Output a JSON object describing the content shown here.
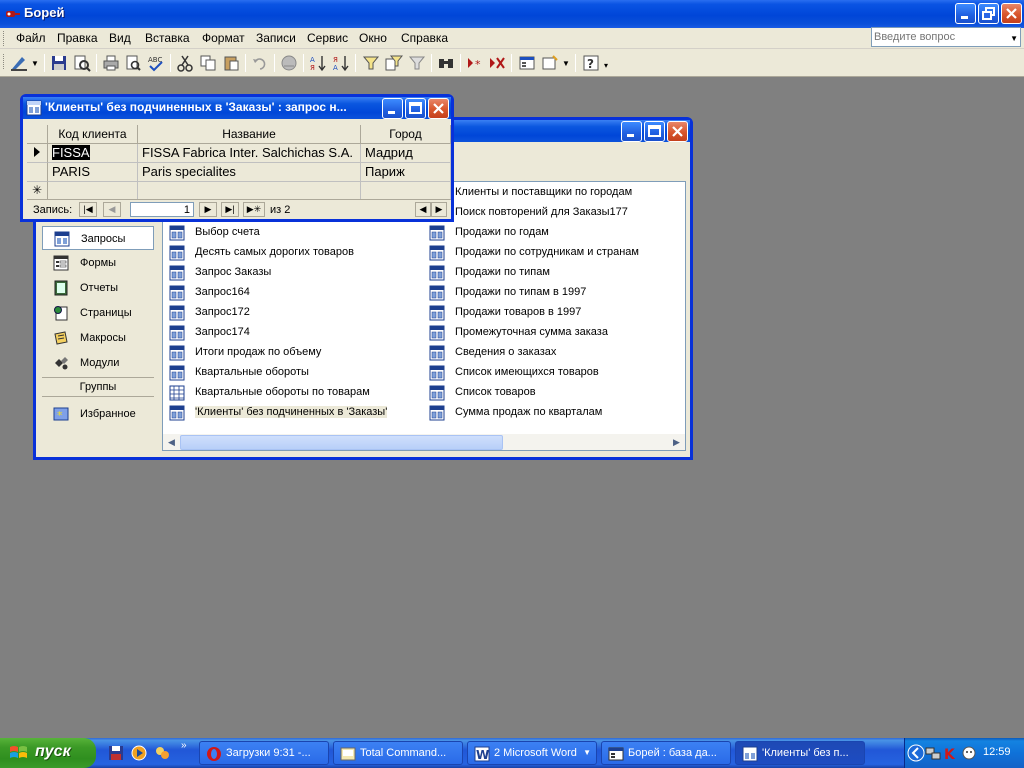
{
  "app": {
    "title": "Борей"
  },
  "menu": {
    "items": [
      "Файл",
      "Правка",
      "Вид",
      "Вставка",
      "Формат",
      "Записи",
      "Сервис",
      "Окно",
      "Справка"
    ],
    "help_placeholder": "Введите вопрос"
  },
  "query_window": {
    "title": "'Клиенты' без подчиненных в 'Заказы' : запрос н...",
    "columns": [
      "Код клиента",
      "Название",
      "Город"
    ],
    "rows": [
      [
        "FISSA",
        "FISSA Fabrica Inter. Salchichas S.A.",
        "Мадрид"
      ],
      [
        "PARIS",
        "Paris specialites",
        "Париж"
      ]
    ],
    "nav": {
      "label": "Запись:",
      "current": "1",
      "of_label": "из",
      "total": "2"
    }
  },
  "db_window": {
    "objects_panel": [
      "Запросы",
      "Формы",
      "Отчеты",
      "Страницы",
      "Макросы",
      "Модули"
    ],
    "groups_label": "Группы",
    "favorites_label": "Избранное",
    "queries_col1": [
      "Выбор счета",
      "Десять самых дорогих товаров",
      "Запрос Заказы",
      "Запрос164",
      "Запрос172",
      "Запрос174",
      "Итоги продаж по объему",
      "Квартальные обороты",
      "Квартальные обороты по товарам",
      "'Клиенты' без подчиненных в 'Заказы'"
    ],
    "queries_col2": [
      "Клиенты и поставщики по городам",
      "Поиск повторений для Заказы177",
      "Продажи по годам",
      "Продажи по сотрудникам и странам",
      "Продажи по типам",
      "Продажи по типам в 1997",
      "Продажи товаров в 1997",
      "Промежуточная сумма заказа",
      "Сведения о заказах",
      "Список имеющихся товаров",
      "Список товаров",
      "Сумма продаж по кварталам"
    ]
  },
  "taskbar": {
    "start_label": "пуск",
    "tasks": [
      "Загрузки 9:31 -...",
      "Total Command...",
      "2 Microsoft Word",
      "Борей : база да...",
      "'Клиенты' без п..."
    ],
    "clock": "12:59"
  }
}
